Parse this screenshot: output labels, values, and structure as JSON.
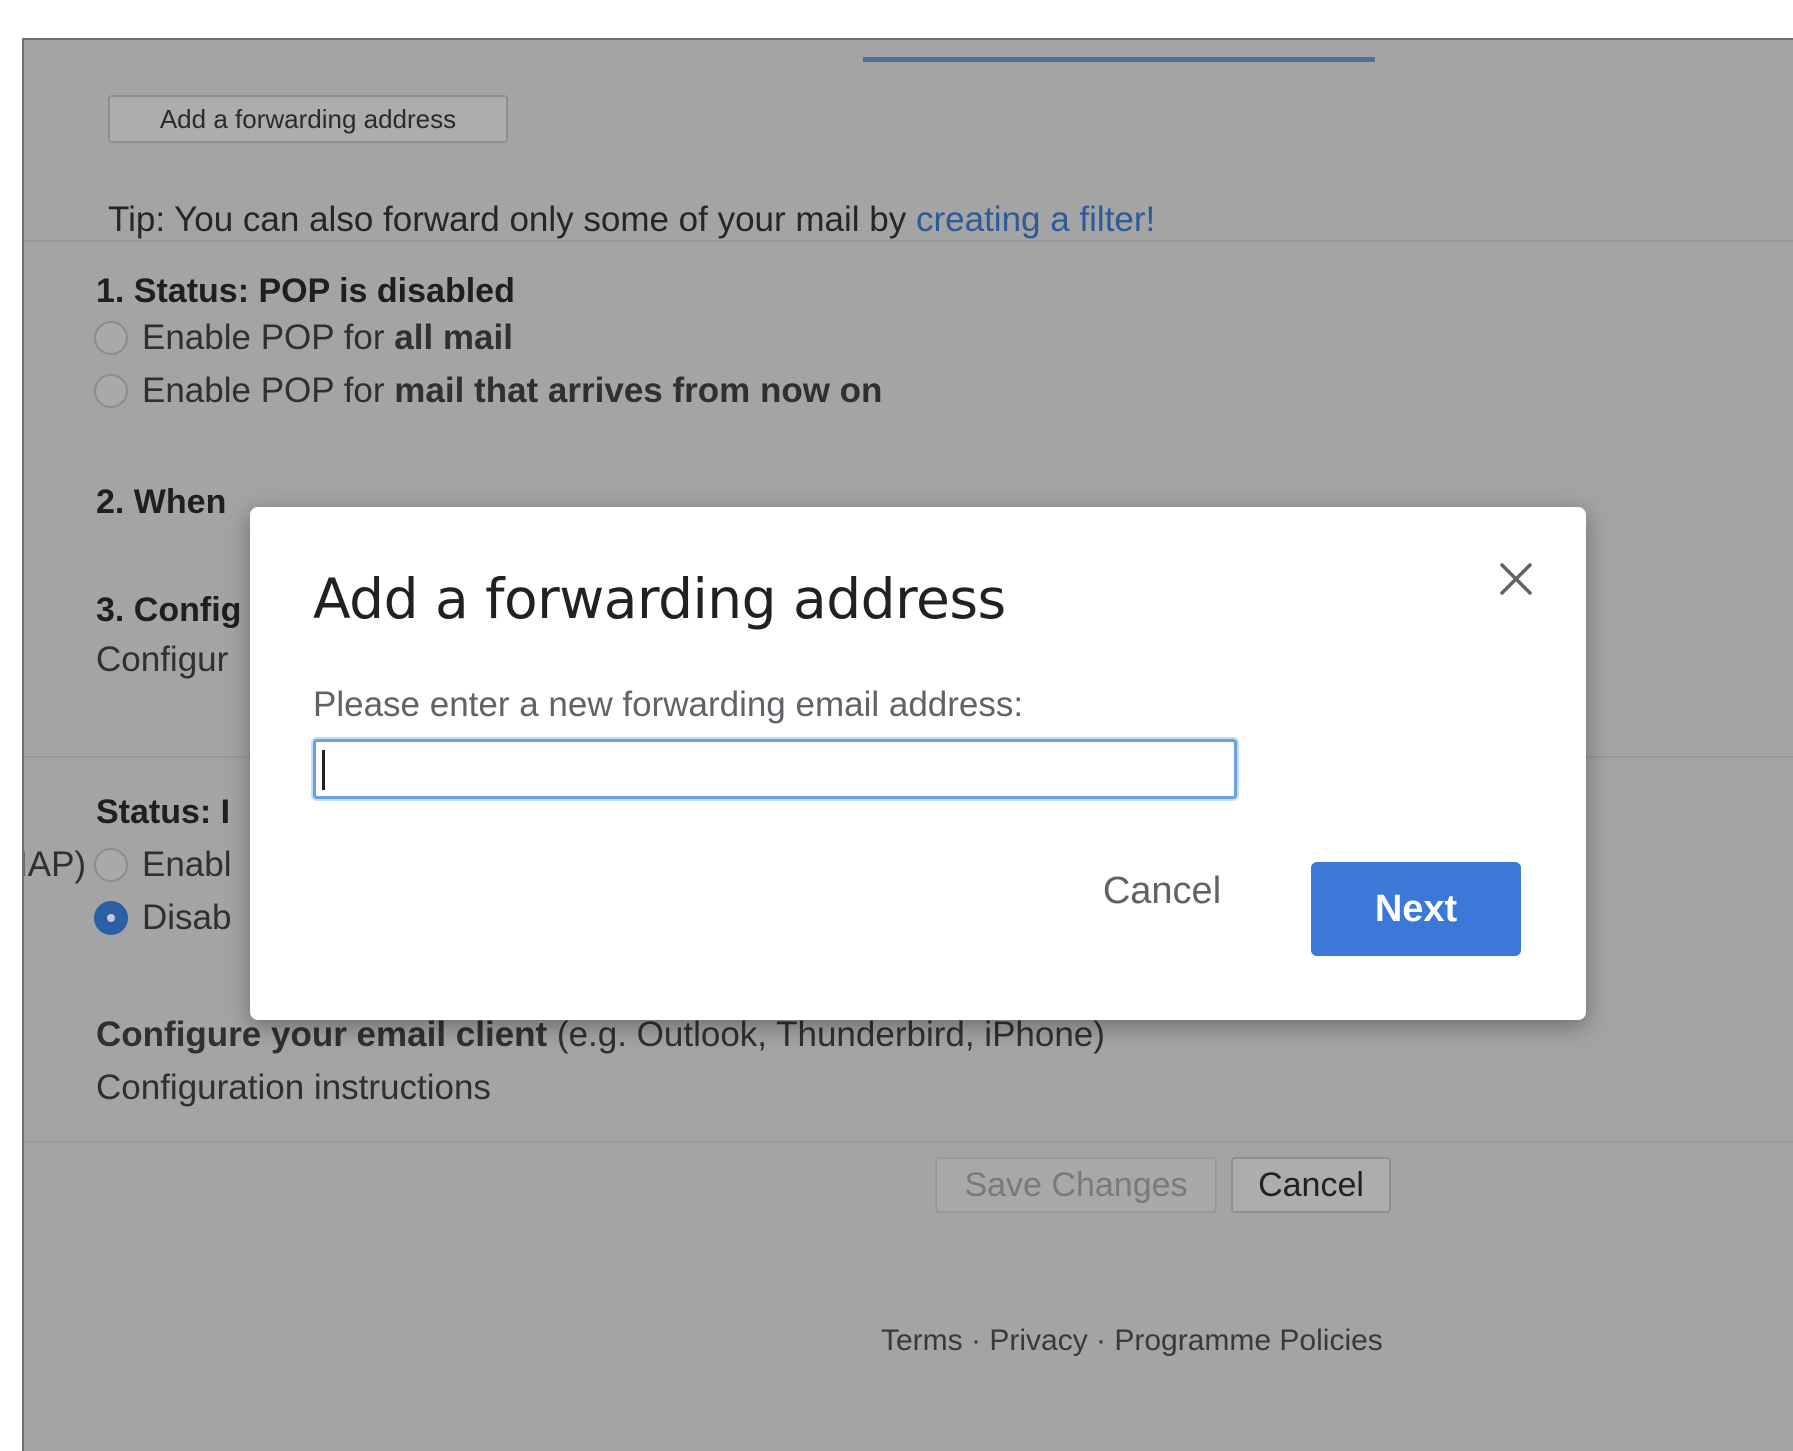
{
  "settings": {
    "add_forwarding_button": "Add a forwarding address",
    "tip_prefix": "Tip: You can also forward only some of your mail by ",
    "tip_link": "creating a filter!",
    "pop": {
      "status_heading": "1. Status: POP is disabled",
      "option1_prefix": "Enable POP for ",
      "option1_bold": "all mail",
      "option2_prefix": "Enable POP for ",
      "option2_bold": "mail that arrives from now on",
      "step2_partial": "2. When",
      "step3_partial": "3. Config",
      "config_link_partial": "Configur"
    },
    "imap": {
      "side_label_partial": "IAP)",
      "status_partial": "Status: I",
      "enable_partial": "Enabl",
      "disable_partial": "Disab",
      "client_bold": "Configure your email client",
      "client_rest": " (e.g. Outlook, Thunderbird, iPhone)",
      "config_link": "Configuration instructions"
    },
    "save_changes": "Save Changes",
    "cancel": "Cancel"
  },
  "footer": {
    "terms": "Terms",
    "separator": " · ",
    "privacy": "Privacy",
    "programme_policies": "Programme Policies"
  },
  "modal": {
    "title": "Add a forwarding address",
    "label": "Please enter a new forwarding email address:",
    "input_value": "",
    "cancel": "Cancel",
    "next": "Next"
  },
  "icons": {
    "close": "close-icon",
    "radio": "radio-button"
  },
  "colors": {
    "accent": "#3c78d8",
    "link": "#2d5a9b",
    "overlay_bg": "#a4a4a4"
  }
}
